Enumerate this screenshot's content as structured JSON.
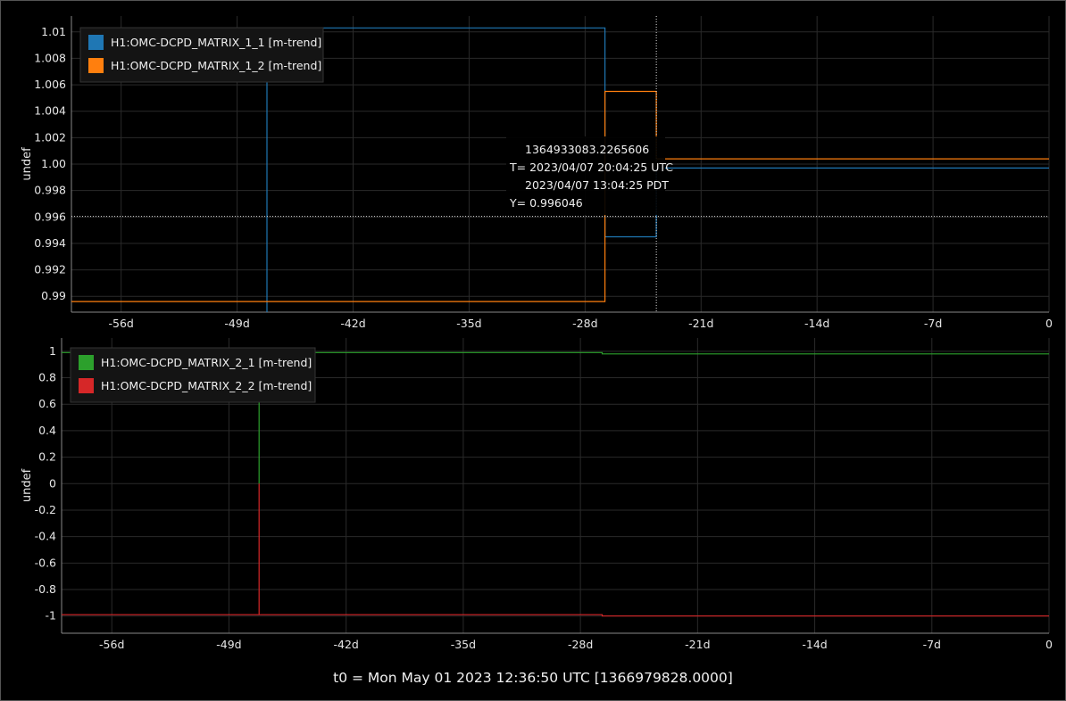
{
  "footer": "t0 = Mon May 01 2023 12:36:50 UTC [1366979828.0000]",
  "tooltip": {
    "gps": "1364933083.2265606",
    "t_utc": "T= 2023/04/07 20:04:25 UTC",
    "t_pdt": "2023/04/07 13:04:25 PDT",
    "y": "Y= 0.996046"
  },
  "colors": {
    "background": "#000000",
    "blue": "#1f77b4",
    "orange": "#ff7f0e",
    "green": "#2ca02c",
    "red": "#d62728"
  },
  "chart_data": [
    {
      "type": "line",
      "ylabel": "undef",
      "xlabel": "",
      "legend_position": "top-left",
      "grid": true,
      "x_tick_labels": [
        "-56d",
        "-49d",
        "-42d",
        "-35d",
        "-28d",
        "-21d",
        "-14d",
        "-7d",
        "0"
      ],
      "x_tick_values": [
        -56,
        -49,
        -42,
        -35,
        -28,
        -21,
        -14,
        -7,
        0
      ],
      "y_tick_labels": [
        "0.99",
        "0.992",
        "0.994",
        "0.996",
        "0.998",
        "1.00",
        "1.002",
        "1.004",
        "1.006",
        "1.008",
        "1.01"
      ],
      "y_tick_values": [
        0.99,
        0.992,
        0.994,
        0.996,
        0.998,
        1.0,
        1.002,
        1.004,
        1.006,
        1.008,
        1.01
      ],
      "xlim": [
        -59,
        0
      ],
      "ylim": [
        0.9888,
        1.0112
      ],
      "cursor": {
        "x": -23.7,
        "y": 0.996046
      },
      "series": [
        {
          "name": "H1:OMC-DCPD_MATRIX_1_1 [m-trend]",
          "color": "#1f77b4",
          "x": [
            -47.2,
            -47.2,
            -26.8,
            -26.8,
            -23.7,
            -23.7,
            0
          ],
          "y": [
            0.9888,
            1.0103,
            1.0103,
            0.9945,
            0.9945,
            0.9997,
            0.9997
          ]
        },
        {
          "name": "H1:OMC-DCPD_MATRIX_1_2 [m-trend]",
          "color": "#ff7f0e",
          "x": [
            -59,
            -26.8,
            -26.8,
            -23.7,
            -23.7,
            0
          ],
          "y": [
            0.9896,
            0.9896,
            1.0055,
            1.0055,
            1.0004,
            1.0004
          ]
        }
      ]
    },
    {
      "type": "line",
      "ylabel": "undef",
      "xlabel": "",
      "legend_position": "top-left",
      "grid": true,
      "x_tick_labels": [
        "-56d",
        "-49d",
        "-42d",
        "-35d",
        "-28d",
        "-21d",
        "-14d",
        "-7d",
        "0"
      ],
      "x_tick_values": [
        -56,
        -49,
        -42,
        -35,
        -28,
        -21,
        -14,
        -7,
        0
      ],
      "y_tick_labels": [
        "-1",
        "-0.8",
        "-0.6",
        "-0.4",
        "-0.2",
        "0",
        "0.2",
        "0.4",
        "0.6",
        "0.8",
        "1"
      ],
      "y_tick_values": [
        -1,
        -0.8,
        -0.6,
        -0.4,
        -0.2,
        0,
        0.2,
        0.4,
        0.6,
        0.8,
        1
      ],
      "xlim": [
        -59,
        0
      ],
      "ylim": [
        -1.13,
        1.1
      ],
      "series": [
        {
          "name": "H1:OMC-DCPD_MATRIX_2_1 [m-trend]",
          "color": "#2ca02c",
          "x": [
            -59,
            -47.2,
            -47.2,
            -47.2,
            -26.7,
            -26.7,
            0
          ],
          "y": [
            0.99,
            0.99,
            0.0,
            0.99,
            0.99,
            0.98,
            0.98
          ]
        },
        {
          "name": "H1:OMC-DCPD_MATRIX_2_2 [m-trend]",
          "color": "#d62728",
          "x": [
            -59,
            -47.2,
            -47.2,
            -47.2,
            -26.7,
            -26.7,
            0
          ],
          "y": [
            -0.99,
            -0.99,
            0.0,
            -0.99,
            -0.99,
            -1.0,
            -1.0
          ]
        }
      ]
    }
  ]
}
